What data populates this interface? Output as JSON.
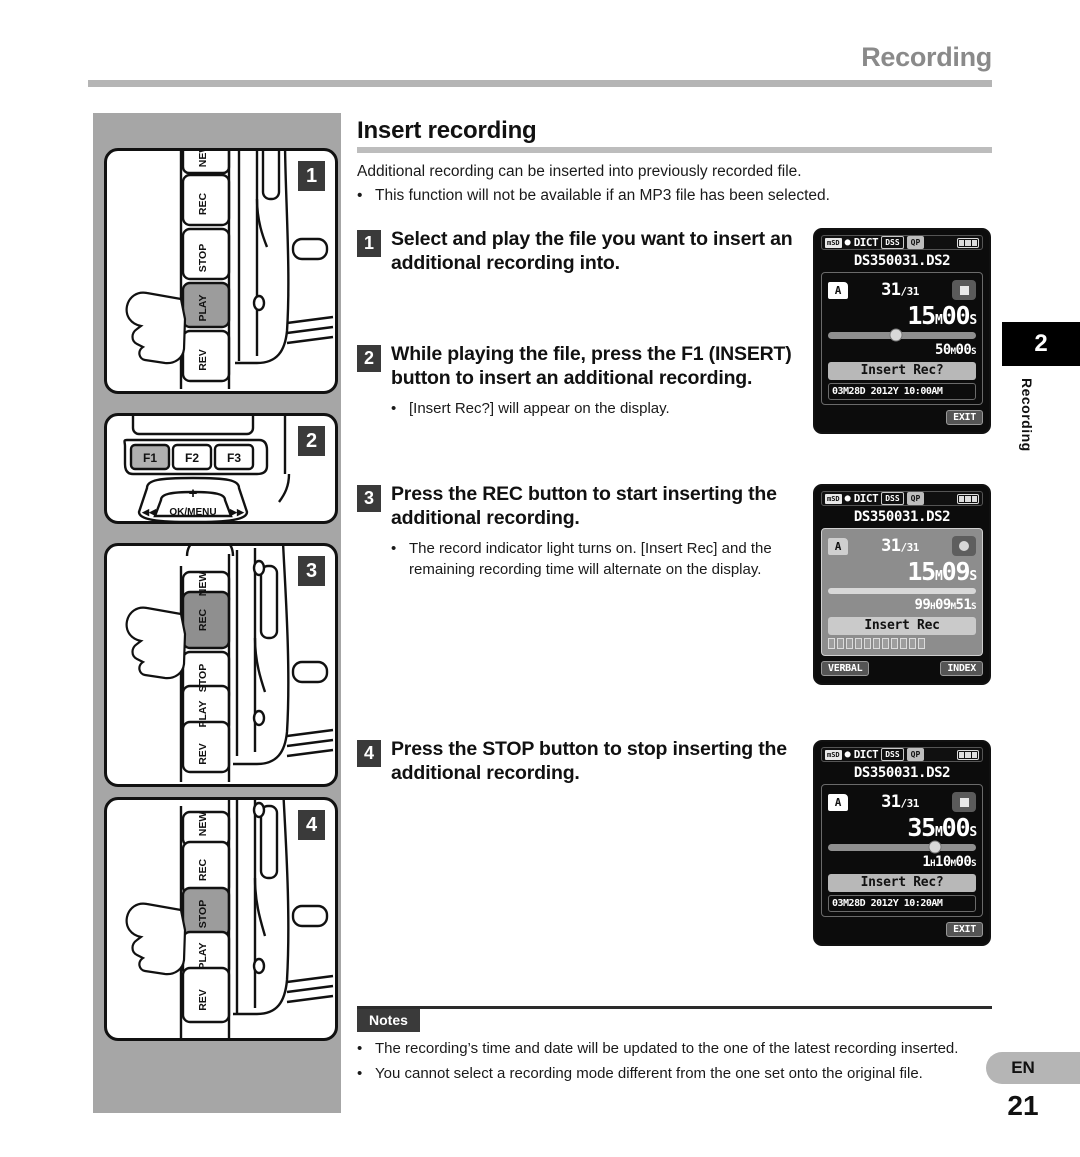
{
  "header": {
    "chapter": "Recording"
  },
  "section": {
    "title": "Insert recording",
    "intro_line": "Additional recording can be inserted into previously recorded file.",
    "intro_bullet": "This function will not be available if an MP3 file has been selected.",
    "bullet_glyph": "•"
  },
  "steps": [
    {
      "num": "1",
      "text": "Select and play the file you want to insert an additional recording into.",
      "note": ""
    },
    {
      "num": "2",
      "text": "While playing the file, press the F1 (INSERT) button to insert an additional recording.",
      "note": "[Insert Rec?] will appear on the display."
    },
    {
      "num": "3",
      "text": "Press the REC button to start inserting the additional recording.",
      "note": "The record indicator light turns on. [Insert Rec] and the remaining recording time will alternate on the display."
    },
    {
      "num": "4",
      "text": "Press the STOP button to stop inserting the additional recording.",
      "note": ""
    }
  ],
  "panels": [
    {
      "num": "1",
      "buttons": [
        "NEW",
        "REC",
        "STOP",
        "PLAY",
        "REV"
      ],
      "highlighted": "PLAY"
    },
    {
      "num": "2",
      "buttons": [
        "F1",
        "F2",
        "F3"
      ],
      "highlighted": "F1",
      "pad_label": "OK/MENU",
      "pad_plus": "+",
      "pad_left": "◀◀",
      "pad_right": "▶▶"
    },
    {
      "num": "3",
      "buttons": [
        "NEW",
        "REC",
        "STOP",
        "PLAY",
        "REV"
      ],
      "highlighted": "REC"
    },
    {
      "num": "4",
      "buttons": [
        "NEW",
        "REC",
        "STOP",
        "PLAY",
        "REV"
      ],
      "highlighted": "STOP"
    }
  ],
  "lcds": [
    {
      "id": "lcd-step1",
      "status": {
        "card": "mSD",
        "mic_icon": "🎙",
        "mode": "DICT",
        "format": "DSS",
        "quality": "QP"
      },
      "file_name": "DS350031.DS2",
      "folder": "A",
      "track_current": "31",
      "track_total": "/31",
      "state_icon": "stop-square",
      "elapsed": "15",
      "elapsed_unit_m": "M",
      "elapsed_sec": "00",
      "elapsed_unit_s": "S",
      "progress_percent": 46,
      "total_time": "50",
      "total_unit_m": "M",
      "total_sec": "00",
      "total_unit_s": "S",
      "message": "Insert Rec?",
      "date_line": "03M28D 2012Y 10:00AM",
      "softkey_right": "EXIT"
    },
    {
      "id": "lcd-step3",
      "status": {
        "card": "mSD",
        "mic_icon": "🎙",
        "mode": "DICT",
        "format": "DSS",
        "quality": "QP"
      },
      "file_name": "DS350031.DS2",
      "folder": "A",
      "track_current": "31",
      "track_total": "/31",
      "state_icon": "record-circle",
      "elapsed": "15",
      "elapsed_unit_m": "M",
      "elapsed_sec": "09",
      "elapsed_unit_s": "S",
      "progress_percent": 99,
      "remain_h": "99",
      "remain_unit_h": "H",
      "remain_m": "09",
      "remain_unit_m": "M",
      "remain_s": "51",
      "remain_unit_s": "S",
      "message": "Insert Rec",
      "softkey_left": "VERBAL",
      "softkey_right": "INDEX"
    },
    {
      "id": "lcd-step4",
      "status": {
        "card": "mSD",
        "mic_icon": "🎙",
        "mode": "DICT",
        "format": "DSS",
        "quality": "QP"
      },
      "file_name": "DS350031.DS2",
      "folder": "A",
      "track_current": "31",
      "track_total": "/31",
      "state_icon": "stop-square",
      "elapsed": "35",
      "elapsed_unit_m": "M",
      "elapsed_sec": "00",
      "elapsed_unit_s": "S",
      "progress_percent": 72,
      "total_h": "1",
      "total_unit_h": "H",
      "total_time": "10",
      "total_unit_m": "M",
      "total_sec": "00",
      "total_unit_s": "S",
      "message": "Insert Rec?",
      "date_line": "03M28D 2012Y 10:20AM",
      "softkey_right": "EXIT"
    }
  ],
  "notes": {
    "label": "Notes",
    "items": [
      "The recording’s time and date will be updated to the one of the latest recording inserted.",
      "You cannot select a recording mode different from the one set onto the original file."
    ]
  },
  "edge": {
    "tab_number": "2",
    "tab_label": "Recording",
    "language": "EN",
    "page_number": "21"
  },
  "colors": {
    "accent_gray": "#a6a6a6",
    "rule_gray": "#b5b5b5",
    "dark": "#3a3a3a",
    "lcd_bg": "#0c0c0c"
  }
}
